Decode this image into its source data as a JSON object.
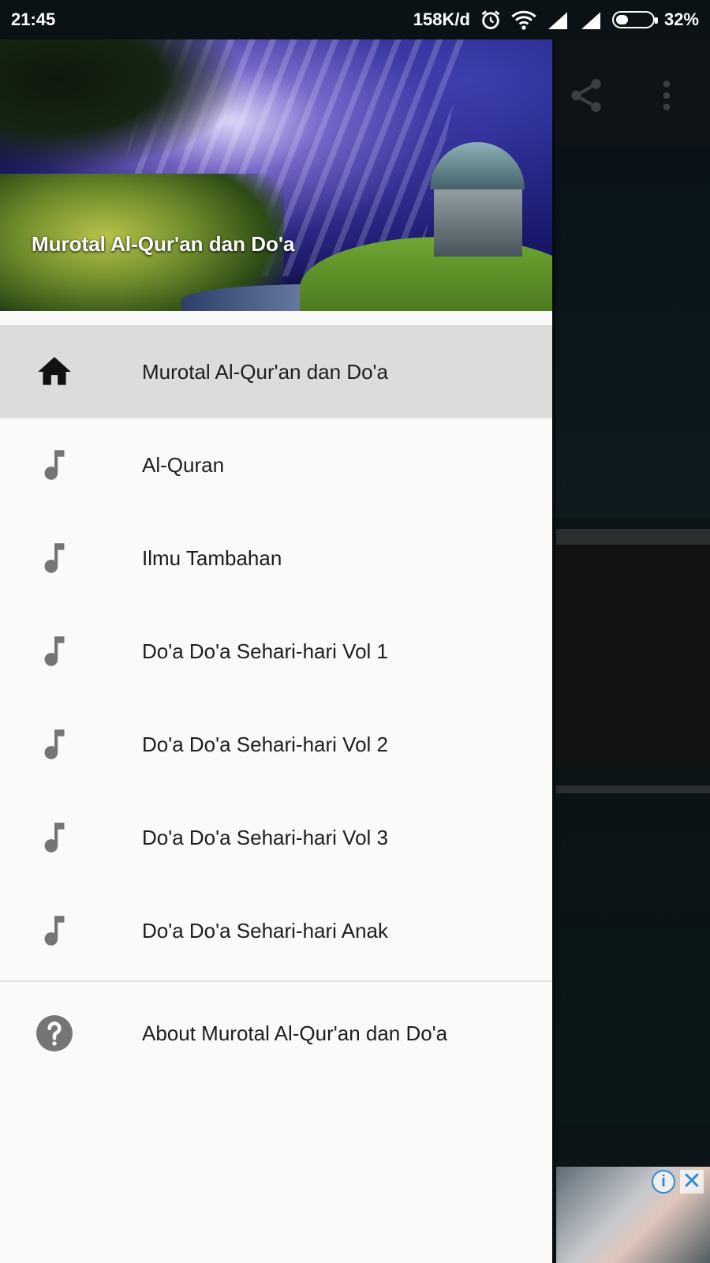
{
  "status_bar": {
    "time": "21:45",
    "network_speed": "158K/d",
    "battery_percent": "32%",
    "battery_level": 0.32,
    "icons": [
      "alarm-icon",
      "wifi-icon",
      "signal-icon",
      "signal-icon",
      "battery-icon"
    ]
  },
  "drawer": {
    "header_title": "Murotal Al-Qur'an dan Do'a",
    "items": [
      {
        "label": "Murotal Al-Qur'an dan Do'a",
        "icon": "home-icon",
        "active": true
      },
      {
        "label": "Al-Quran",
        "icon": "music-note-icon"
      },
      {
        "label": "Ilmu Tambahan",
        "icon": "music-note-icon"
      },
      {
        "label": "Do'a Do'a Sehari-hari Vol 1",
        "icon": "music-note-icon"
      },
      {
        "label": "Do'a Do'a Sehari-hari Vol 2",
        "icon": "music-note-icon"
      },
      {
        "label": "Do'a Do'a Sehari-hari Vol 3",
        "icon": "music-note-icon"
      },
      {
        "label": "Do'a Do'a Sehari-hari Anak",
        "icon": "music-note-icon"
      }
    ],
    "footer_items": [
      {
        "label": "About Murotal Al-Qur'an dan Do'a",
        "icon": "help-icon"
      }
    ]
  },
  "background_toolbar": {
    "icons": [
      "share-icon",
      "more-vert-icon"
    ]
  },
  "ad": {
    "icons": [
      "info-icon",
      "close-icon"
    ]
  },
  "colors": {
    "drawer_bg": "#fafafa",
    "active_item_bg": "#dcdcdc",
    "icon_gray": "#757575",
    "scrim": "#0b1012"
  }
}
